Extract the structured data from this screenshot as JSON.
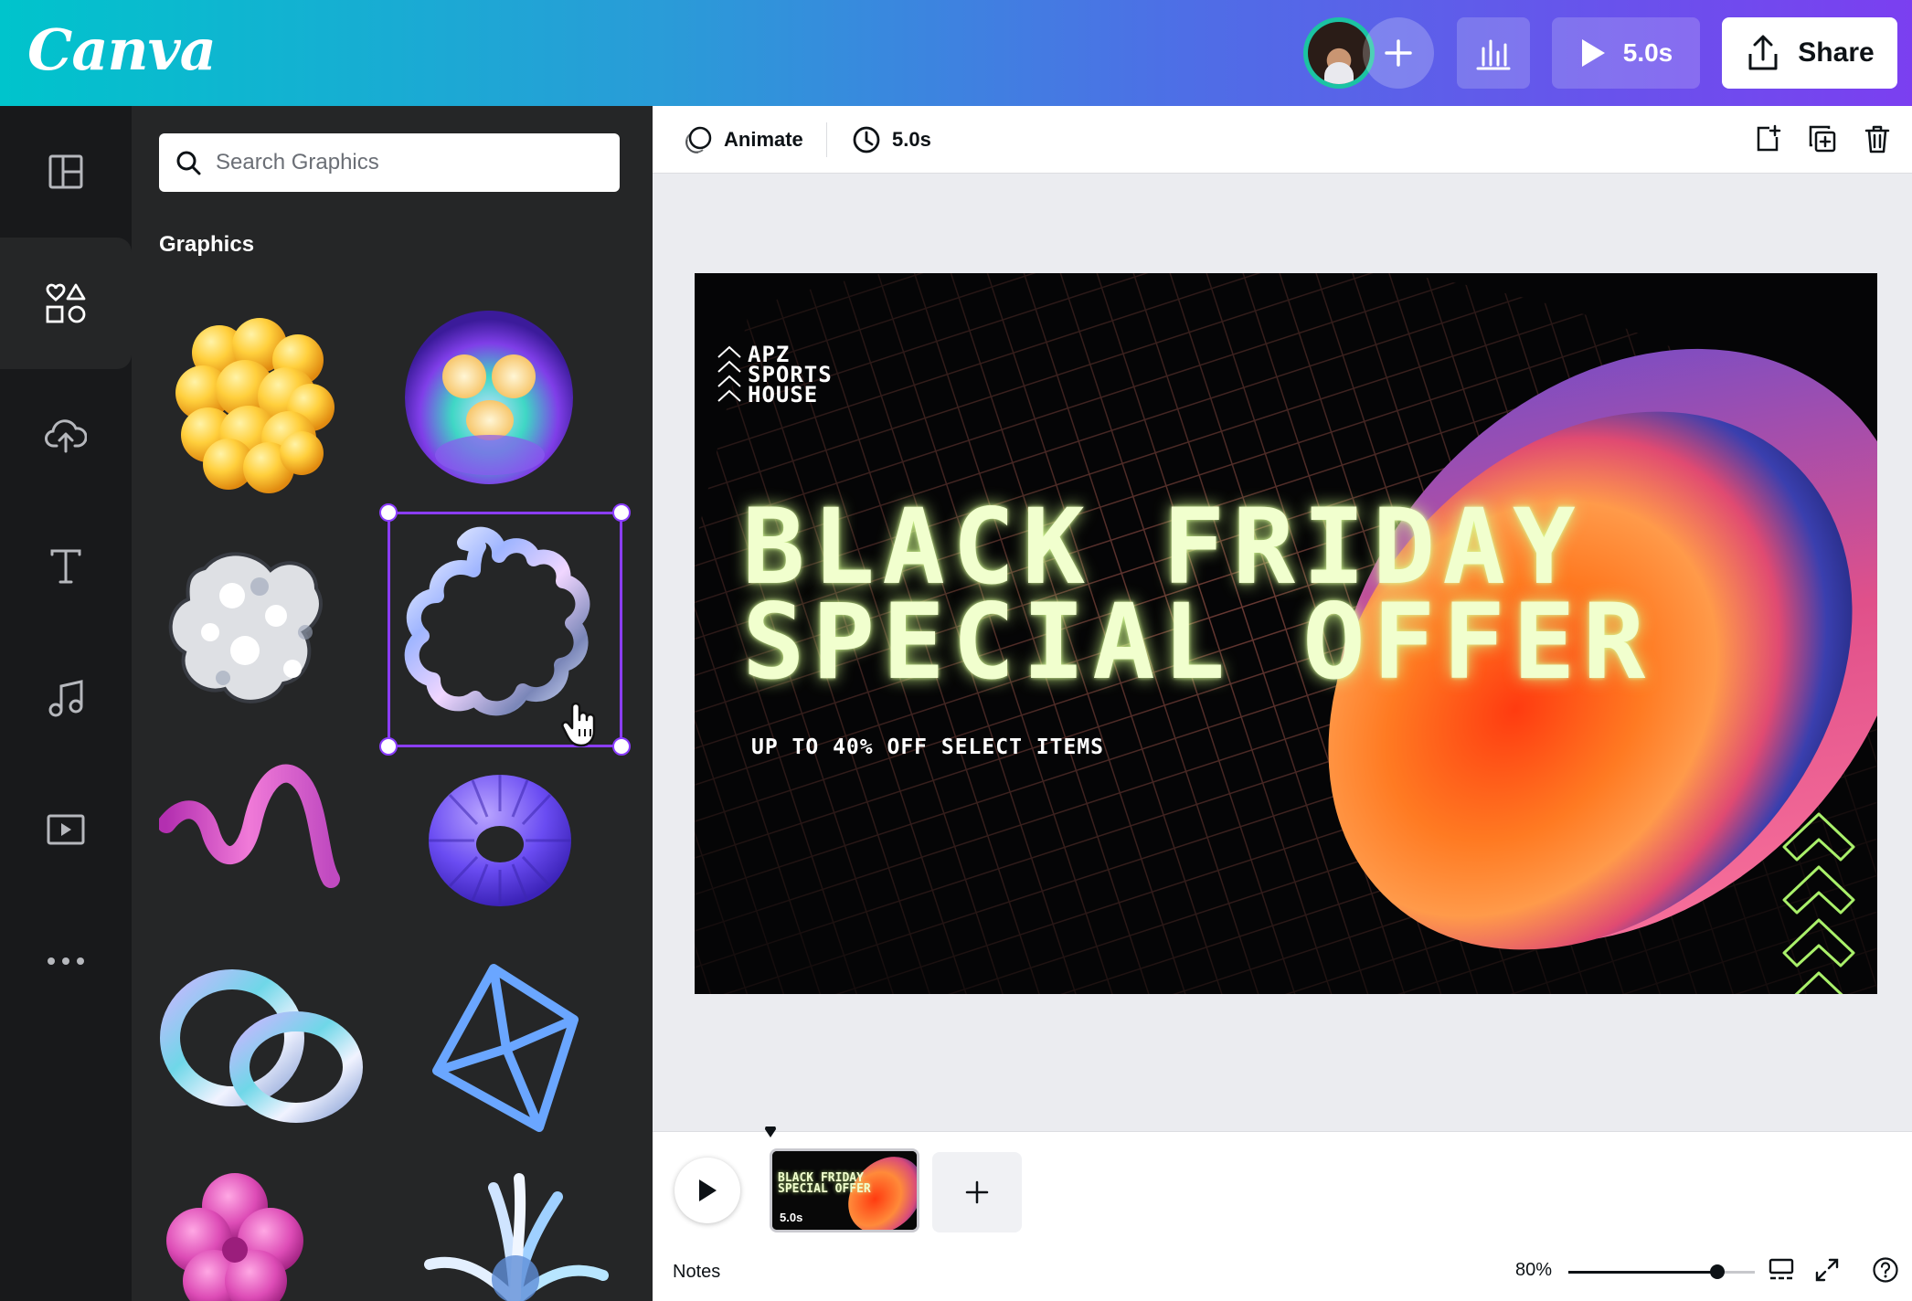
{
  "header": {
    "logo": "Canva",
    "present_duration": "5.0s",
    "share_label": "Share"
  },
  "rail": {
    "items": [
      {
        "icon": "templates-icon",
        "active": false
      },
      {
        "icon": "elements-icon",
        "active": true
      },
      {
        "icon": "uploads-icon",
        "active": false
      },
      {
        "icon": "text-icon",
        "active": false
      },
      {
        "icon": "audio-icon",
        "active": false
      },
      {
        "icon": "videos-icon",
        "active": false
      },
      {
        "icon": "more-icon",
        "active": false
      }
    ]
  },
  "panel": {
    "search_placeholder": "Search Graphics",
    "section_title": "Graphics"
  },
  "toolbar": {
    "animate_label": "Animate",
    "duration_label": "5.0s"
  },
  "design": {
    "brand_line1": "APZ",
    "brand_line2": "SPORTS",
    "brand_line3": "HOUSE",
    "headline_line1": "BLACK FRIDAY",
    "headline_line2": "SPECIAL OFFER",
    "subline": "UP TO 40% OFF SELECT ITEMS"
  },
  "timeline": {
    "page_duration": "5.0s",
    "thumb_title_line1": "BLACK FRIDAY",
    "thumb_title_line2": "SPECIAL OFFER",
    "notes_label": "Notes",
    "zoom_label": "80%",
    "zoom_fraction": 0.8
  },
  "colors": {
    "accent": "#8b3dff",
    "headline": "#f1ffce",
    "rail_bg": "#18191b",
    "panel_bg": "#252627"
  }
}
